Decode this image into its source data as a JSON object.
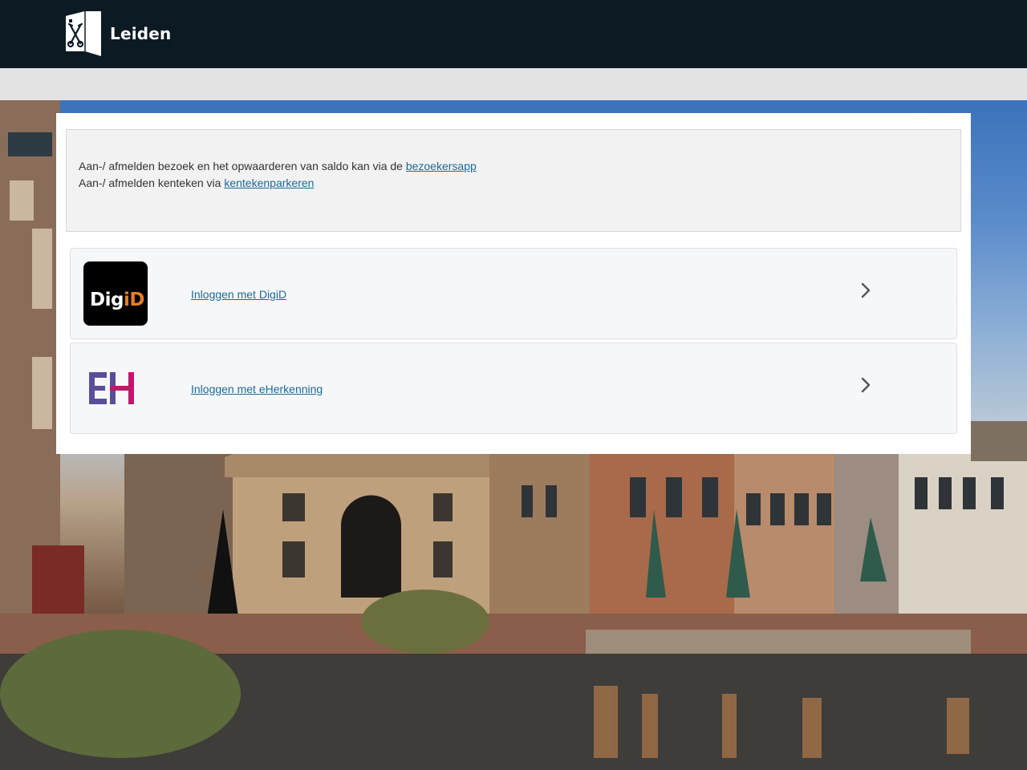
{
  "header": {
    "site_name": "Leiden"
  },
  "notice": {
    "line1_text": "Aan-/ afmelden bezoek en het opwaarderen van saldo kan via de ",
    "line1_link": "bezoekersapp",
    "line2_text": "Aan-/ afmelden kenteken via ",
    "line2_link": "kentekenparkeren"
  },
  "login_options": [
    {
      "label": "Inloggen met DigiD",
      "logo_text_white": "Dig",
      "logo_text_orange": "iD",
      "icon": "digid-logo",
      "arrow_icon": "chevron-right-icon"
    },
    {
      "label": "Inloggen met eHerkenning",
      "icon": "eherkenning-logo",
      "arrow_icon": "chevron-right-icon"
    }
  ],
  "colors": {
    "header_bg": "#0c1a24",
    "subbar_bg": "#e3e3e3",
    "link": "#1a6a9a",
    "digid_orange": "#e67e22",
    "eh_purple": "#5a4e9a",
    "eh_magenta": "#c4166b"
  }
}
